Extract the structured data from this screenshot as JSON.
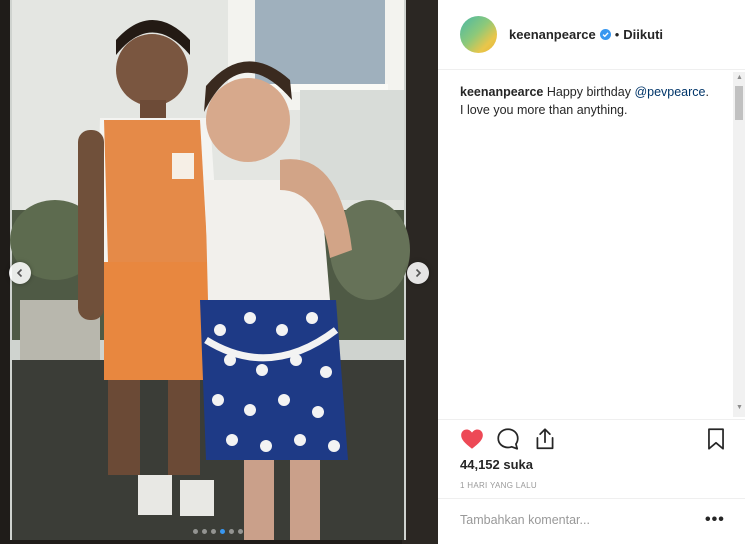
{
  "post": {
    "username": "keenanpearce",
    "follow_state": "Diikuti",
    "separator": "•",
    "caption_user": "keenanpearce",
    "caption_text_1": "Happy birthday",
    "caption_mention": "@pevpearce",
    "caption_text_2": ". I love you more than anything.",
    "likes": "44,152 suka",
    "timestamp": "1 HARI YANG LALU",
    "comment_placeholder": "Tambahkan komentar...",
    "more_label": "•••"
  },
  "carousel": {
    "slides": 6,
    "active_index": 3
  },
  "icons": {
    "like": "heart-filled-icon",
    "comment": "comment-bubble-icon",
    "share": "share-icon",
    "save": "bookmark-icon",
    "verified": "verified-badge-icon",
    "prev": "chevron-left-icon",
    "next": "chevron-right-icon"
  },
  "colors": {
    "heart": "#ed4956",
    "verified": "#3897f0",
    "mention": "#003569",
    "active_dot": "#3897f0"
  }
}
